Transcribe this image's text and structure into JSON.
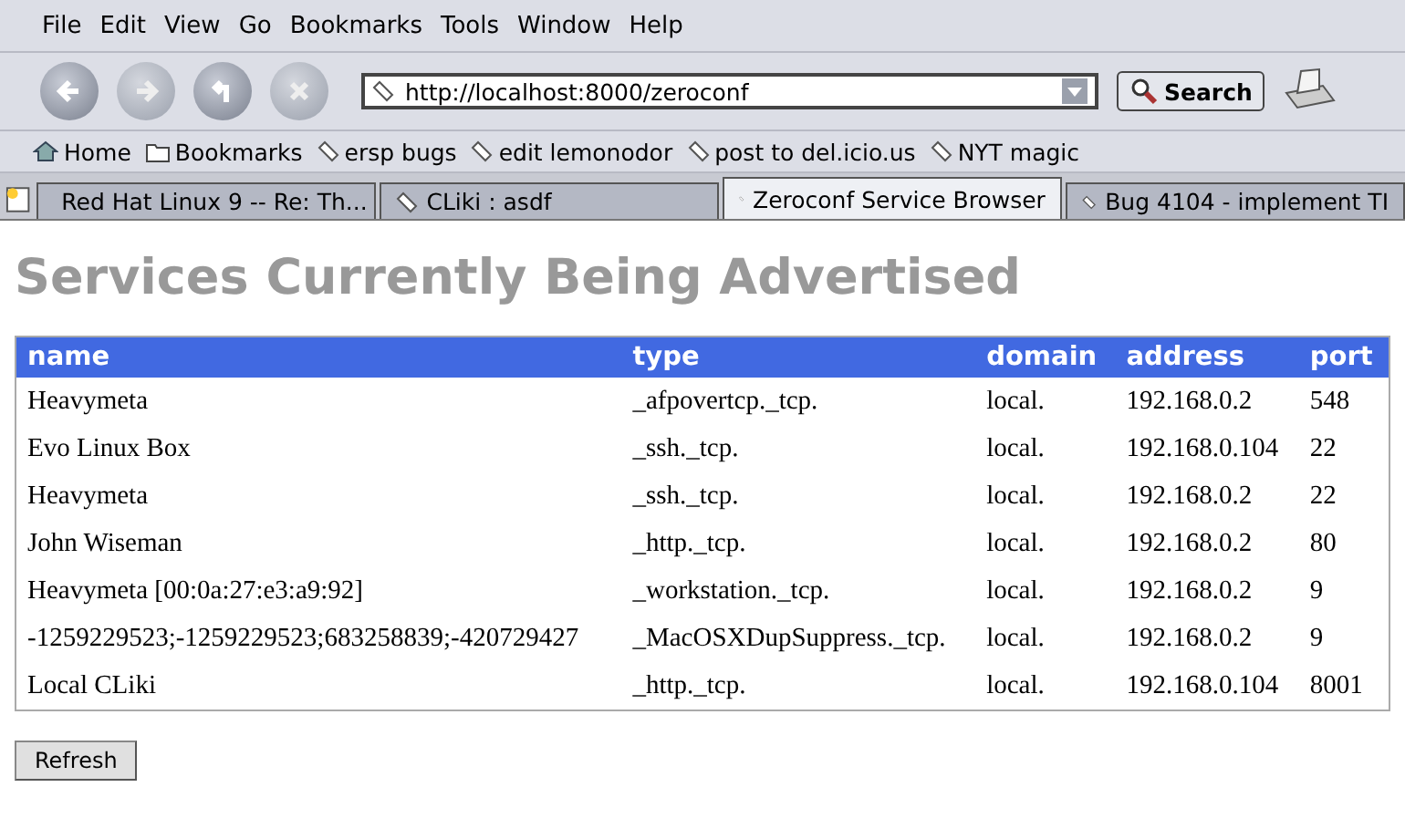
{
  "menu": [
    "File",
    "Edit",
    "View",
    "Go",
    "Bookmarks",
    "Tools",
    "Window",
    "Help"
  ],
  "toolbar": {
    "url": "http://localhost:8000/zeroconf",
    "search_button": "Search"
  },
  "bookmarks": [
    {
      "label": "Home",
      "kind": "home"
    },
    {
      "label": "Bookmarks",
      "kind": "folder"
    },
    {
      "label": "ersp bugs",
      "kind": "link"
    },
    {
      "label": "edit lemonodor",
      "kind": "link"
    },
    {
      "label": "post to del.icio.us",
      "kind": "link"
    },
    {
      "label": "NYT magic",
      "kind": "link"
    }
  ],
  "tabs": [
    {
      "label": "Red Hat Linux 9 -- Re: Th...",
      "selected": false
    },
    {
      "label": "CLiki : asdf",
      "selected": false
    },
    {
      "label": "Zeroconf Service Browser",
      "selected": true
    },
    {
      "label": "Bug 4104 - implement TI",
      "selected": false
    }
  ],
  "page": {
    "heading": "Services Currently Being Advertised",
    "table": {
      "columns": [
        "name",
        "type",
        "domain",
        "address",
        "port"
      ],
      "rows": [
        [
          "Heavymeta",
          "_afpovertcp._tcp.",
          "local.",
          "192.168.0.2",
          "548"
        ],
        [
          "Evo Linux Box",
          "_ssh._tcp.",
          "local.",
          "192.168.0.104",
          "22"
        ],
        [
          "Heavymeta",
          "_ssh._tcp.",
          "local.",
          "192.168.0.2",
          "22"
        ],
        [
          "John Wiseman",
          "_http._tcp.",
          "local.",
          "192.168.0.2",
          "80"
        ],
        [
          "Heavymeta [00:0a:27:e3:a9:92]",
          "_workstation._tcp.",
          "local.",
          "192.168.0.2",
          "9"
        ],
        [
          "-1259229523;-1259229523;683258839;-420729427",
          "_MacOSXDupSuppress._tcp.",
          "local.",
          "192.168.0.2",
          "9"
        ],
        [
          "Local CLiki",
          "_http._tcp.",
          "local.",
          "192.168.0.104",
          "8001"
        ]
      ]
    },
    "refresh_button": "Refresh"
  }
}
